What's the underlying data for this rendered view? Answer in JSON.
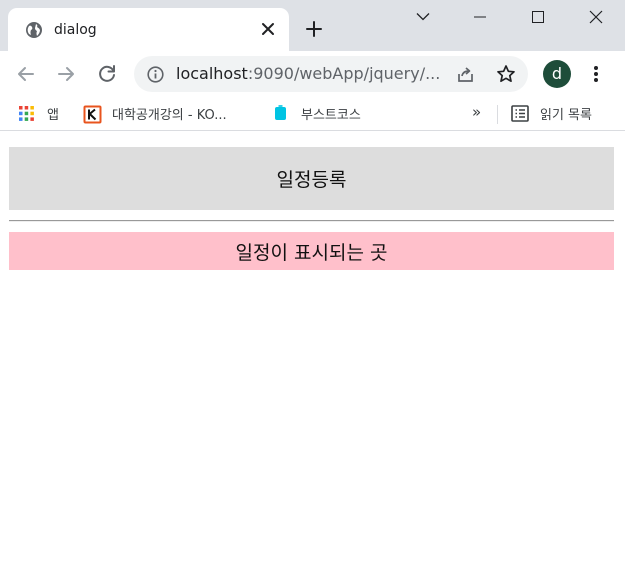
{
  "browser": {
    "tab": {
      "title": "dialog"
    },
    "window_controls": [
      "chevron-down",
      "minimize",
      "maximize",
      "close"
    ],
    "address": {
      "url_host": "localhost",
      "url_rest": ":9090/webApp/jquery/..."
    },
    "profile_initial": "d",
    "colors": {
      "tabstrip": "#dee1e6",
      "avatar": "#1e4d3a"
    }
  },
  "bookmarks": {
    "items": [
      {
        "label": "앱",
        "icon": "apps-grid-icon"
      },
      {
        "label": "대학공개강의 - KO...",
        "icon": "kocw-icon"
      },
      {
        "label": "부스트코스",
        "icon": "boostcourse-icon"
      }
    ],
    "overflow": "»",
    "reading_list": "읽기 목록"
  },
  "page": {
    "schedule_button": "일정등록",
    "schedule_area": "일정이 표시되는 곳",
    "colors": {
      "button_bg": "#dddddd",
      "area_bg": "#ffc0cb"
    }
  }
}
